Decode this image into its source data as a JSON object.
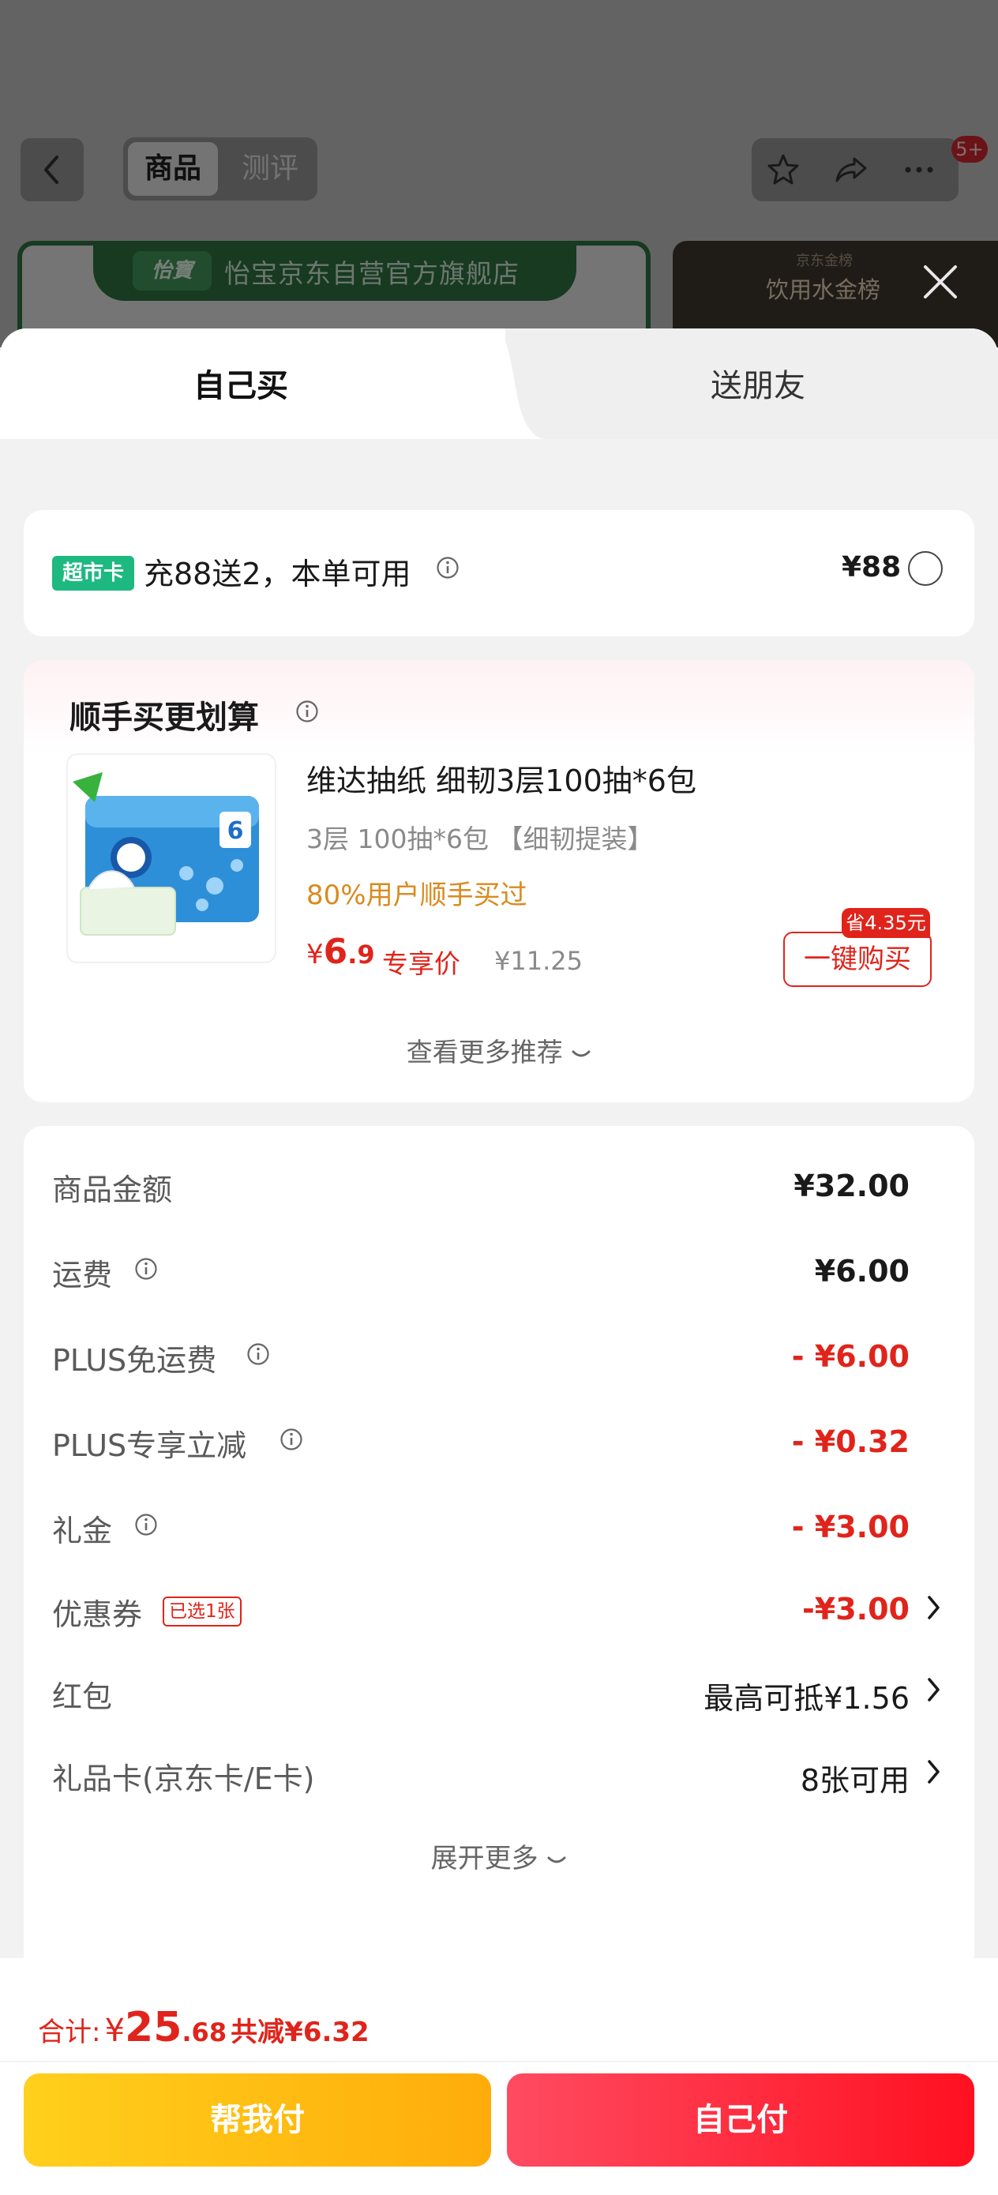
{
  "background": {
    "tabs": [
      "商品",
      "测评"
    ],
    "notification_badge": "5+",
    "store_logo": "怡寶",
    "store_name": "怡宝京东自营官方旗舰店",
    "gold_card_top": "京东金榜",
    "gold_card_title": "饮用水金榜"
  },
  "sheet": {
    "tab_self": "自己买",
    "tab_friend": "送朋友"
  },
  "supermarket": {
    "chip": "超市卡",
    "text": "充88送2，本单可用",
    "price": "¥88"
  },
  "addon": {
    "title": "顺手买更划算",
    "product_name": "维达抽纸 细韧3层100抽*6包",
    "spec": "3层 100抽*6包 【细韧提装】",
    "bought": "80%用户顺手买过",
    "price_currency": "¥",
    "price_int": "6",
    "price_dec": ".9",
    "price_tag": "专享价",
    "orig_price": "¥11.25",
    "save_badge": "省4.35元",
    "buy_button": "一键购买",
    "more": "查看更多推荐"
  },
  "summary": {
    "rows": [
      {
        "label": "商品金额",
        "value": "¥32.00"
      },
      {
        "label": "运费",
        "value": "¥6.00"
      },
      {
        "label": "PLUS免运费",
        "value": "- ¥6.00"
      },
      {
        "label": "PLUS专享立减",
        "value": "- ¥0.32"
      },
      {
        "label": "礼金",
        "value": "- ¥3.00"
      },
      {
        "label": "优惠券",
        "value": "-¥3.00",
        "badge": "已选1张"
      },
      {
        "label": "红包",
        "value": "最高可抵¥1.56"
      },
      {
        "label": "礼品卡(京东卡/E卡)",
        "value": "8张可用"
      }
    ],
    "expand": "展开更多"
  },
  "bottom": {
    "total_label": "合计:",
    "total_currency": "¥",
    "total_int": "25",
    "total_dec": ".68",
    "total_cut": "共减¥6.32",
    "help_pay": "帮我付",
    "self_pay": "自己付"
  },
  "colors": {
    "accent_red": "#e0241b",
    "chip_green": "#1db980",
    "bought_orange": "#d98b1e",
    "help_btn": "#ffbe12",
    "pay_btn": "#ff2d3c"
  },
  "icons": [
    "back-chevron-icon",
    "star-icon",
    "share-icon",
    "more-dots-icon",
    "close-icon",
    "info-icon",
    "chevron-right-icon",
    "chevron-down-icon"
  ]
}
